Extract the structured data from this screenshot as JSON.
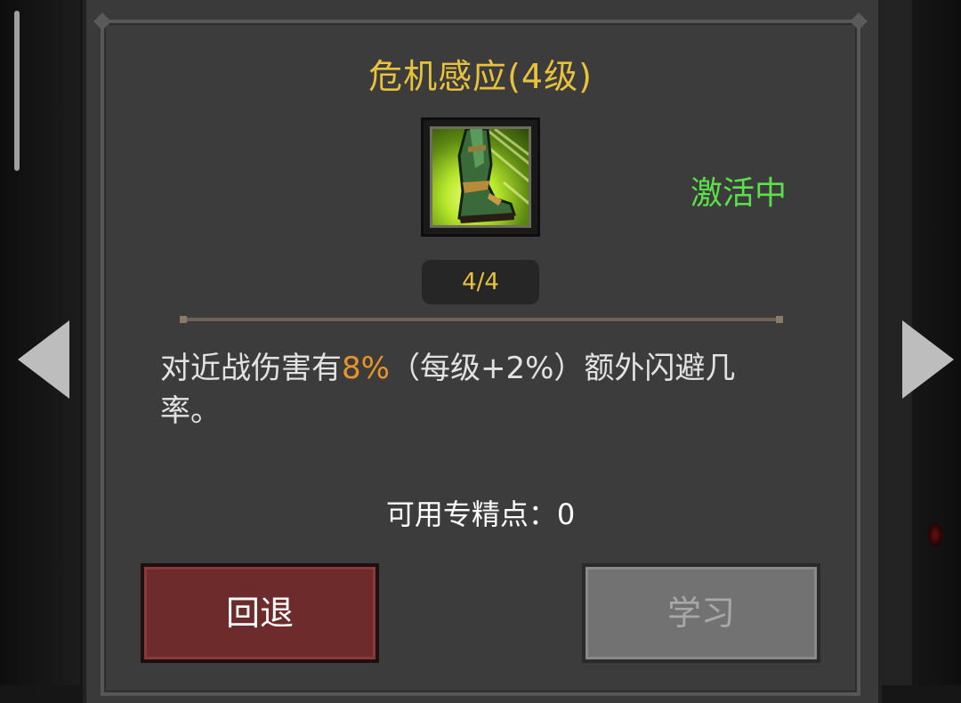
{
  "skill": {
    "title": "危机感应(4级)",
    "icon": "boot-icon",
    "status": "激活中",
    "status_color": "#5ce04a",
    "level_text": "4/4",
    "level_value": 4,
    "level_max": 4
  },
  "description": {
    "before": "对近战伤害有",
    "highlight": "8%",
    "after": "（每级+2%）额外闪避几率。",
    "highlight_color": "#e8942a"
  },
  "points": {
    "label": "可用专精点：0"
  },
  "buttons": {
    "back_label": "回退",
    "learn_label": "学习"
  },
  "navigation": {
    "prev_icon": "arrow-left-icon",
    "next_icon": "arrow-right-icon"
  },
  "colors": {
    "title": "#e8c23c",
    "back_button": "#6e2b2b",
    "learn_button_disabled": "#727272"
  }
}
